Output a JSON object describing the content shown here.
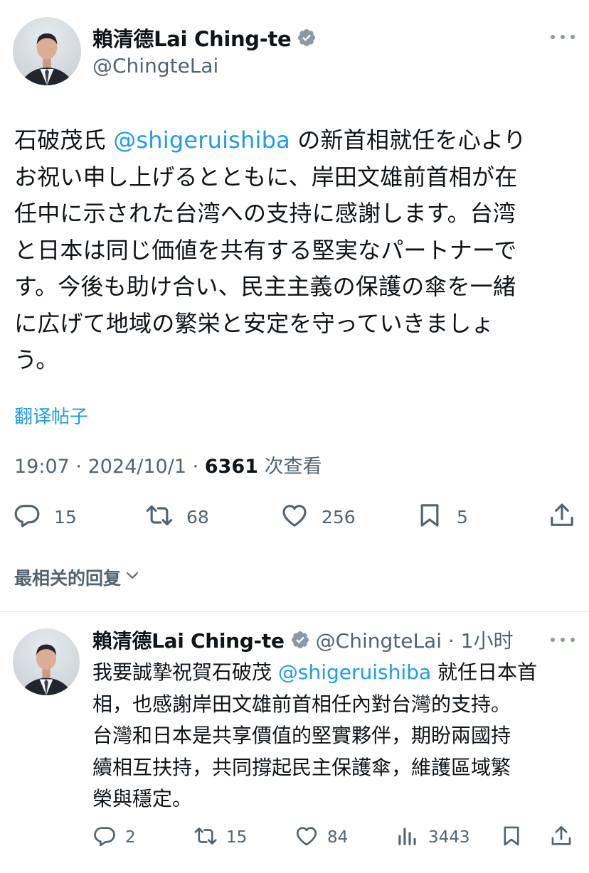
{
  "tweet": {
    "display_name": "賴清德Lai Ching-te",
    "handle": "@ChingteLai",
    "text_before": "石破茂氏 ",
    "mention": "@shigeruishiba",
    "text_after": " の新首相就任を心より\nお祝い申し上げるとともに、岸田文雄前首相が在\n任中に示された台湾への支持に感謝します。台湾\nと日本は同じ価値を共有する堅実なパートナーで\nす。今後も助け合い、民主主義の保護の傘を一緒\nに広げて地域の繁栄と安定を守っていきましょ\nう。",
    "translate_label": "翻译帖子",
    "time": "19:07",
    "separator": " · ",
    "date": "2024/10/1",
    "views_count": "6361",
    "views_label": "次查看",
    "stats": {
      "replies": "15",
      "reposts": "68",
      "likes": "256",
      "bookmarks": "5"
    }
  },
  "replies_sort_label": "最相关的回复",
  "reply": {
    "display_name": "賴清德Lai Ching-te",
    "handle_time": "@ChingteLai · 1小时",
    "text_before": "我要誠摯祝賀石破茂 ",
    "mention": "@shigeruishiba",
    "text_after": " 就任日本首\n相，也感謝岸田文雄前首相任內對台灣的支持。\n台灣和日本是共享價值的堅實夥伴，期盼兩國持\n續相互扶持，共同撐起民主保護傘，維護區域繁\n榮與穩定。",
    "stats": {
      "replies": "2",
      "reposts": "15",
      "likes": "84",
      "views": "3443"
    }
  },
  "colors": {
    "link": "#1d9bf0",
    "text": "#0f1419",
    "secondary": "#536471",
    "verified_badge": "#8b98a5"
  },
  "icons": [
    "verified-icon",
    "more-icon",
    "reply-icon",
    "repost-icon",
    "like-icon",
    "bookmark-icon",
    "share-icon",
    "views-icon",
    "chevron-down-icon"
  ]
}
